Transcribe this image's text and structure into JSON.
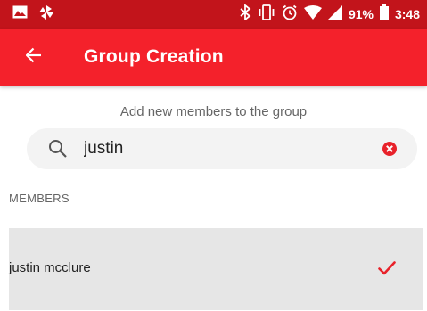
{
  "status_bar": {
    "battery_percent": "91%",
    "time": "3:48"
  },
  "app_bar": {
    "title": "Group Creation"
  },
  "search": {
    "prompt": "Add new members to the group",
    "query": "justin"
  },
  "members": {
    "header": "MEMBERS",
    "items": [
      {
        "name": "justin mcclure",
        "selected": true
      }
    ]
  },
  "colors": {
    "status_bar": "#c2141b",
    "app_bar": "#f4212b",
    "accent": "#e8222a"
  },
  "icons": {
    "status_left": [
      "image-icon",
      "pinwheel-icon"
    ],
    "status_right": [
      "bluetooth-icon",
      "vibrate-icon",
      "alarm-icon",
      "wifi-icon",
      "signal-icon",
      "battery-icon"
    ],
    "app_bar": "back-arrow-icon",
    "search": "search-icon",
    "clear": "clear-icon",
    "selected": "check-icon"
  }
}
